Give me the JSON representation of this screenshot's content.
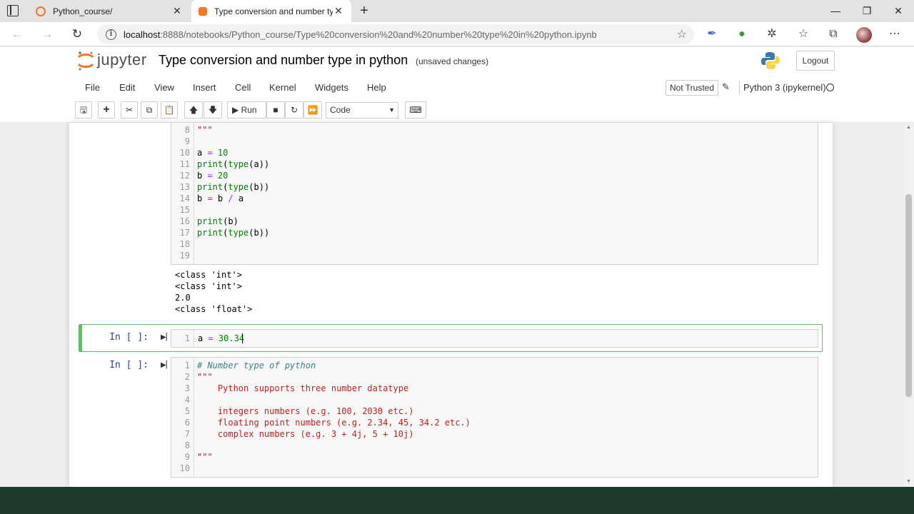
{
  "browser": {
    "tabs": [
      {
        "title": "Python_course/",
        "active": false
      },
      {
        "title": "Type conversion and number typ",
        "active": true
      }
    ],
    "url_host": "localhost",
    "url_rest": ":8888/notebooks/Python_course/Type%20conversion%20and%20number%20type%20in%20python.ipynb"
  },
  "jupyter": {
    "logo_text": "jupyter",
    "notebook_title": "Type conversion and number type in python",
    "save_status": "(unsaved changes)",
    "logout_label": "Logout",
    "menu": [
      "File",
      "Edit",
      "View",
      "Insert",
      "Cell",
      "Kernel",
      "Widgets",
      "Help"
    ],
    "trust_label": "Not Trusted",
    "kernel_name": "Python 3 (ipykernel)",
    "run_label": "Run",
    "cell_type": "Code"
  },
  "cells": {
    "cell1": {
      "lines": [
        {
          "n": "8",
          "code": "\"\"\""
        },
        {
          "n": "9",
          "code": ""
        },
        {
          "n": "10",
          "code": "a = 10"
        },
        {
          "n": "11",
          "code": "print(type(a))"
        },
        {
          "n": "12",
          "code": "b = 20"
        },
        {
          "n": "13",
          "code": "print(type(b))"
        },
        {
          "n": "14",
          "code": "b = b / a"
        },
        {
          "n": "15",
          "code": ""
        },
        {
          "n": "16",
          "code": "print(b)"
        },
        {
          "n": "17",
          "code": "print(type(b))"
        },
        {
          "n": "18",
          "code": ""
        },
        {
          "n": "19",
          "code": ""
        }
      ],
      "output": [
        "<class 'int'>",
        "<class 'int'>",
        "2.0",
        "<class 'float'>"
      ]
    },
    "cell2": {
      "prompt": "In [ ]:",
      "lines": [
        {
          "n": "1",
          "code": "a = 30.34"
        }
      ]
    },
    "cell3": {
      "prompt": "In [ ]:",
      "lines": [
        {
          "n": "1",
          "code": "# Number type of python"
        },
        {
          "n": "2",
          "code": "\"\"\""
        },
        {
          "n": "3",
          "code": "    Python supports three number datatype"
        },
        {
          "n": "4",
          "code": ""
        },
        {
          "n": "5",
          "code": "    integers numbers (e.g. 100, 2030 etc.)"
        },
        {
          "n": "6",
          "code": "    floating point numbers (e.g. 2.34, 45, 34.2 etc.)"
        },
        {
          "n": "7",
          "code": "    complex numbers (e.g. 3 + 4j, 5 + 10j)"
        },
        {
          "n": "8",
          "code": ""
        },
        {
          "n": "9",
          "code": "\"\"\""
        },
        {
          "n": "10",
          "code": ""
        }
      ]
    }
  }
}
